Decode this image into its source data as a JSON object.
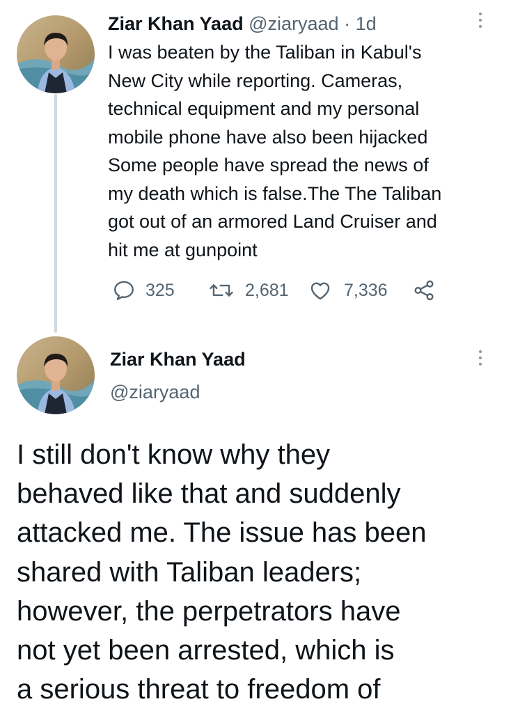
{
  "tweet1": {
    "author_name": "Ziar Khan Yaad",
    "author_handle": "@ziaryaad",
    "separator": "·",
    "time": "1d",
    "text": "I was beaten by the Taliban in Kabul's\nNew City while reporting. Cameras,\ntechnical equipment and my personal\nmobile phone have also been hijacked\nSome people have spread the news of\nmy death which is false.The The Taliban\ngot out of an armored Land Cruiser and\nhit me at gunpoint",
    "replies": "325",
    "retweets": "2,681",
    "likes": "7,336"
  },
  "tweet2": {
    "author_name": "Ziar Khan Yaad",
    "author_handle": "@ziaryaad",
    "text": "I still don't know why they\nbehaved like that and suddenly\nattacked me. The issue has been\nshared with Taliban leaders;\nhowever, the perpetrators have\nnot yet been arrested, which is\na serious threat to freedom of"
  },
  "icons": {
    "reply": "reply-icon",
    "retweet": "retweet-icon",
    "like": "like-icon",
    "share": "share-icon",
    "more": "more-icon"
  },
  "colors": {
    "text": "#0f1419",
    "secondary": "#536471",
    "thread_line": "#cfd9de"
  }
}
